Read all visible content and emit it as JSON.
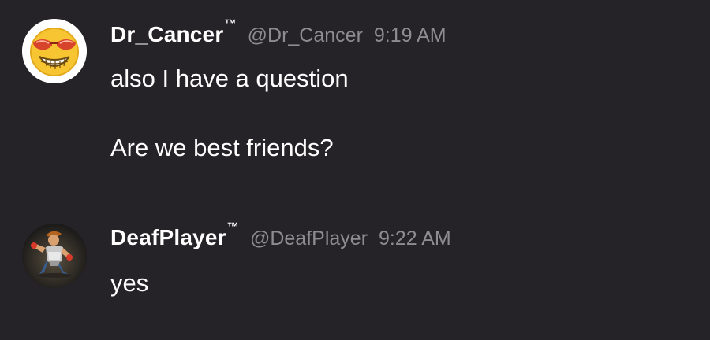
{
  "messages": [
    {
      "display_name": "Dr_Cancer",
      "trademark": "™",
      "handle": "@Dr_Cancer",
      "time": "9:19 AM",
      "avatar_icon": "sunglasses-grin-emoji-icon",
      "lines": [
        "also I have a question",
        "Are we best friends?"
      ]
    },
    {
      "display_name": "DeafPlayer",
      "trademark": "™",
      "handle": "@DeafPlayer",
      "time": "9:22 AM",
      "avatar_icon": "fighter-character-icon",
      "lines": [
        "yes"
      ]
    }
  ],
  "colors": {
    "background": "#252327",
    "name": "#ffffff",
    "meta": "#8e8c91",
    "text": "#ffffff"
  }
}
